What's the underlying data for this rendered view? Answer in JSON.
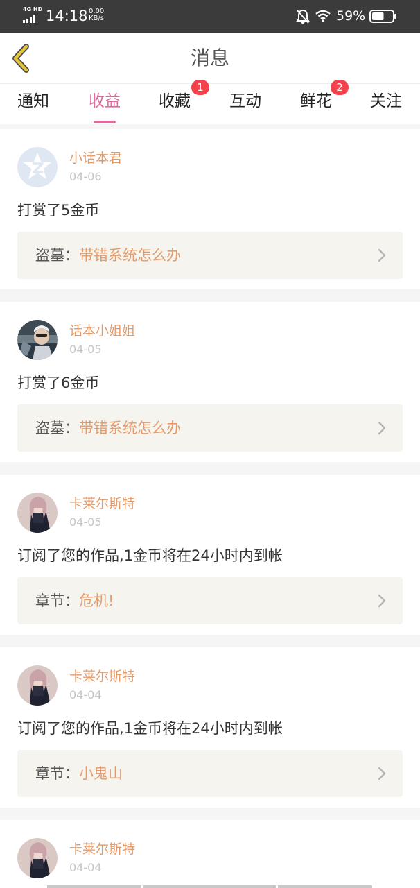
{
  "status_bar": {
    "network": "4G HD",
    "time": "14:18",
    "speed_value": "0.00",
    "speed_unit": "KB/s",
    "battery_percent": "59%",
    "icons": [
      "signal-icon",
      "mute-icon",
      "wifi-icon",
      "battery-icon"
    ],
    "battery_level": 0.59
  },
  "header": {
    "title": "消息",
    "back_icon": "chevron-left-icon"
  },
  "tabs": [
    {
      "label": "通知",
      "badge": ""
    },
    {
      "label": "收益",
      "badge": "",
      "active": true
    },
    {
      "label": "收藏",
      "badge": "1"
    },
    {
      "label": "互动",
      "badge": ""
    },
    {
      "label": "鲜花",
      "badge": "2"
    },
    {
      "label": "关注",
      "badge": ""
    }
  ],
  "messages": [
    {
      "user": "小话本君",
      "date": "04-06",
      "text": "打赏了5金币",
      "link_prefix": "盗墓：",
      "link_title": "带错系统怎么办",
      "avatar": "star-z-logo"
    },
    {
      "user": "话本小姐姐",
      "date": "04-05",
      "text": "打赏了6金币",
      "link_prefix": "盗墓：",
      "link_title": "带错系统怎么办",
      "avatar": "photo-avatar"
    },
    {
      "user": "卡莱尔斯特",
      "date": "04-05",
      "text": "订阅了您的作品,1金币将在24小时内到帐",
      "link_prefix": "章节：",
      "link_title": "危机!",
      "avatar": "anime-avatar"
    },
    {
      "user": "卡莱尔斯特",
      "date": "04-04",
      "text": "订阅了您的作品,1金币将在24小时内到帐",
      "link_prefix": "章节：",
      "link_title": "小鬼山",
      "avatar": "anime-avatar"
    },
    {
      "user": "卡莱尔斯特",
      "date": "04-04",
      "text": "",
      "link_prefix": "",
      "link_title": "",
      "avatar": "anime-avatar"
    }
  ],
  "colors": {
    "accent": "#e06a9e",
    "username": "#e39b6b",
    "badge": "#f5414c",
    "link_box": "#f6f4ef",
    "back_arrow": "#e4c53a"
  }
}
